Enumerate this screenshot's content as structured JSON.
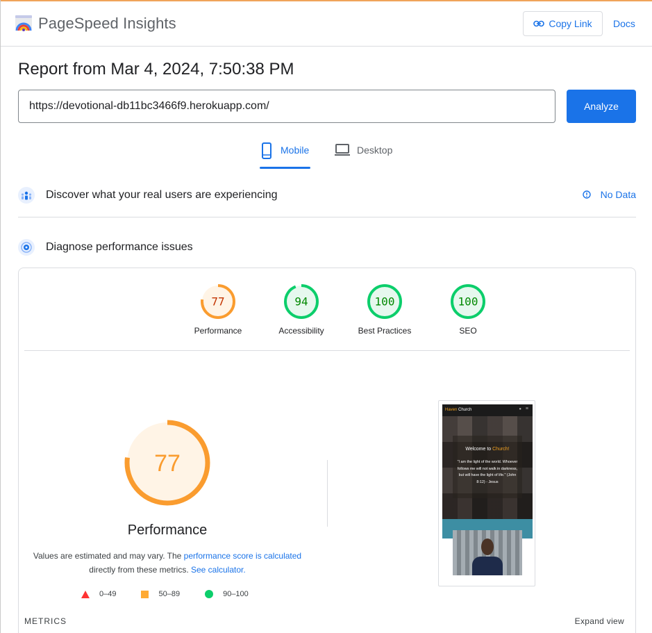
{
  "header": {
    "brand": "PageSpeed Insights",
    "copy_link_label": "Copy Link",
    "docs_label": "Docs"
  },
  "report": {
    "title": "Report from Mar 4, 2024, 7:50:38 PM",
    "url_value": "https://devotional-db11bc3466f9.herokuapp.com/",
    "analyze_label": "Analyze"
  },
  "tabs": [
    {
      "label": "Mobile",
      "active": true
    },
    {
      "label": "Desktop",
      "active": false
    }
  ],
  "field_section": {
    "title": "Discover what your real users are experiencing",
    "status": "No Data"
  },
  "lab_section": {
    "title": "Diagnose performance issues"
  },
  "scores": [
    {
      "label": "Performance",
      "score": "77",
      "value": 0.77,
      "color": "#fa9c2f",
      "fill": "#fff4e6",
      "text_color": "#c33300"
    },
    {
      "label": "Accessibility",
      "score": "94",
      "value": 0.94,
      "color": "#0cce6b",
      "fill": "#e6f8ee",
      "text_color": "#008800"
    },
    {
      "label": "Best Practices",
      "score": "100",
      "value": 1.0,
      "color": "#0cce6b",
      "fill": "#e6f8ee",
      "text_color": "#008800"
    },
    {
      "label": "SEO",
      "score": "100",
      "value": 1.0,
      "color": "#0cce6b",
      "fill": "#e6f8ee",
      "text_color": "#008800"
    }
  ],
  "performance": {
    "score": "77",
    "value": 0.77,
    "title": "Performance",
    "note_prefix": "Values are estimated and may vary. The ",
    "note_link1": "performance score is calculated",
    "note_middle": "directly from these metrics. ",
    "note_link2": "See calculator."
  },
  "legend": [
    {
      "range": "0–49",
      "shape": "triangle",
      "color": "#ff3333"
    },
    {
      "range": "50–89",
      "shape": "square",
      "color": "#ffaa33"
    },
    {
      "range": "90–100",
      "shape": "circle",
      "color": "#0cce6b"
    }
  ],
  "screenshot": {
    "brand_highlight": "Haven",
    "brand_rest": " Church",
    "welcome_prefix": "Welcome to ",
    "welcome_highlight": "Church!",
    "quote": "\"I am the light of the world. Whoever follows me will not walk in darkness, but will have the light of life.\" (John 8:12) - Jesus"
  },
  "footer": {
    "metrics_label": "METRICS",
    "expand_label": "Expand view"
  }
}
